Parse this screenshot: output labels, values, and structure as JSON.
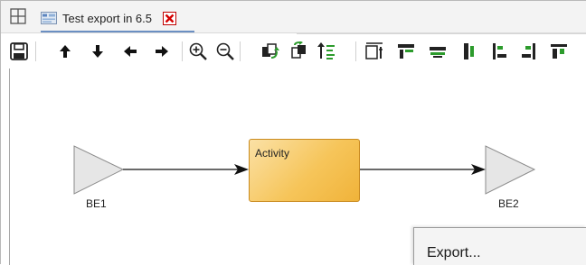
{
  "tab": {
    "title": "Test export in 6.5"
  },
  "toolbar": {
    "buttons": [
      {
        "icon": "save-icon"
      },
      {
        "icon": "arrow-up-icon"
      },
      {
        "icon": "arrow-down-icon"
      },
      {
        "icon": "arrow-left-icon"
      },
      {
        "icon": "arrow-right-icon"
      },
      {
        "icon": "zoom-in-icon"
      },
      {
        "icon": "zoom-out-icon"
      },
      {
        "icon": "bring-forward-icon"
      },
      {
        "icon": "send-backward-icon"
      },
      {
        "icon": "sort-order-icon"
      },
      {
        "icon": "resize-fit-icon"
      },
      {
        "icon": "align-top-icon"
      },
      {
        "icon": "align-middle-icon"
      },
      {
        "icon": "distribute-vertical-icon"
      },
      {
        "icon": "align-left-icon"
      },
      {
        "icon": "align-right-icon"
      },
      {
        "icon": "align-top-edge-icon"
      }
    ]
  },
  "diagram": {
    "start_event": {
      "label": "BE1"
    },
    "activity": {
      "label": "Activity"
    },
    "end_event": {
      "label": "BE2"
    },
    "colors": {
      "activity_fill": "#f6c55a",
      "activity_border": "#c98a1e",
      "event_fill": "#e6e6e6"
    }
  },
  "context_menu": {
    "items": [
      {
        "label": "Export..."
      }
    ]
  }
}
